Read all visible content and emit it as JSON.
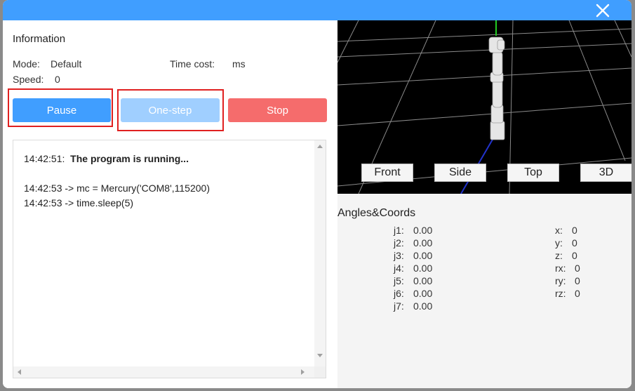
{
  "dialog": {
    "close_icon": "close-icon"
  },
  "info": {
    "title": "Information",
    "mode_label": "Mode:",
    "mode_value": "Default",
    "time_cost_label": "Time cost:",
    "time_cost_unit": "ms",
    "speed_label": "Speed:",
    "speed_value": "0"
  },
  "buttons": {
    "pause": "Pause",
    "one_step": "One-step",
    "stop": "Stop"
  },
  "log": {
    "lines": [
      {
        "time": "14:42:51:",
        "text": "The program is running..."
      },
      {
        "time": "14:42:53",
        "text": "-> mc = Mercury('COM8',115200)"
      },
      {
        "time": "14:42:53",
        "text": "-> time.sleep(5)"
      }
    ]
  },
  "view": {
    "front": "Front",
    "side": "Side",
    "top": "Top",
    "three_d": "3D"
  },
  "coords": {
    "title": "Angles&Coords",
    "joints": [
      {
        "label": "j1:",
        "value": "0.00"
      },
      {
        "label": "j2:",
        "value": "0.00"
      },
      {
        "label": "j3:",
        "value": "0.00"
      },
      {
        "label": "j4:",
        "value": "0.00"
      },
      {
        "label": "j5:",
        "value": "0.00"
      },
      {
        "label": "j6:",
        "value": "0.00"
      },
      {
        "label": "j7:",
        "value": "0.00"
      }
    ],
    "cartesian": [
      {
        "label": "x:",
        "value": "0"
      },
      {
        "label": "y:",
        "value": "0"
      },
      {
        "label": "z:",
        "value": "0"
      },
      {
        "label": "rx:",
        "value": "0"
      },
      {
        "label": "ry:",
        "value": "0"
      },
      {
        "label": "rz:",
        "value": "0"
      }
    ]
  },
  "colors": {
    "titlebar": "#409eff",
    "pause": "#409eff",
    "one_step": "#a0cfff",
    "stop": "#f56c6c",
    "highlight": "#e02020"
  }
}
